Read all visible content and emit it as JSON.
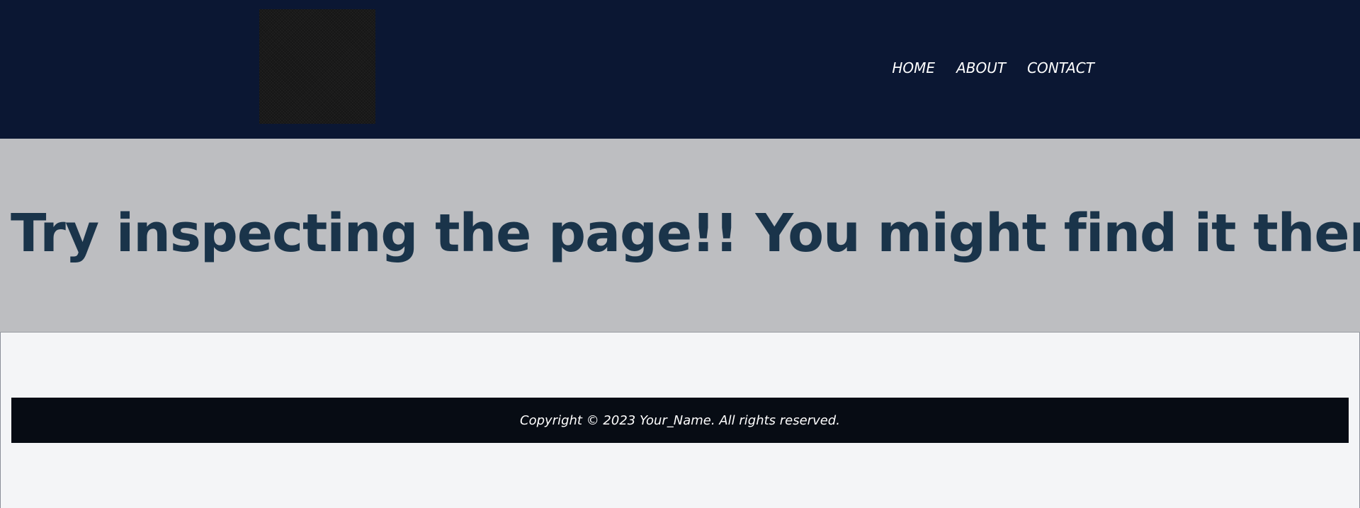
{
  "header": {
    "logo_alt": "logo",
    "nav": [
      {
        "label": "HOME"
      },
      {
        "label": "ABOUT"
      },
      {
        "label": "CONTACT"
      }
    ]
  },
  "hero": {
    "title": "Try inspecting the page!! You might find it there"
  },
  "footer": {
    "copyright": "Copyright © 2023 Your_Name. All rights reserved."
  },
  "colors": {
    "header_bg": "#0b1733",
    "hero_bg": "#bdbec1",
    "hero_text": "#1a344a",
    "page_bg": "#f4f5f7",
    "footer_bg": "#070c14"
  }
}
